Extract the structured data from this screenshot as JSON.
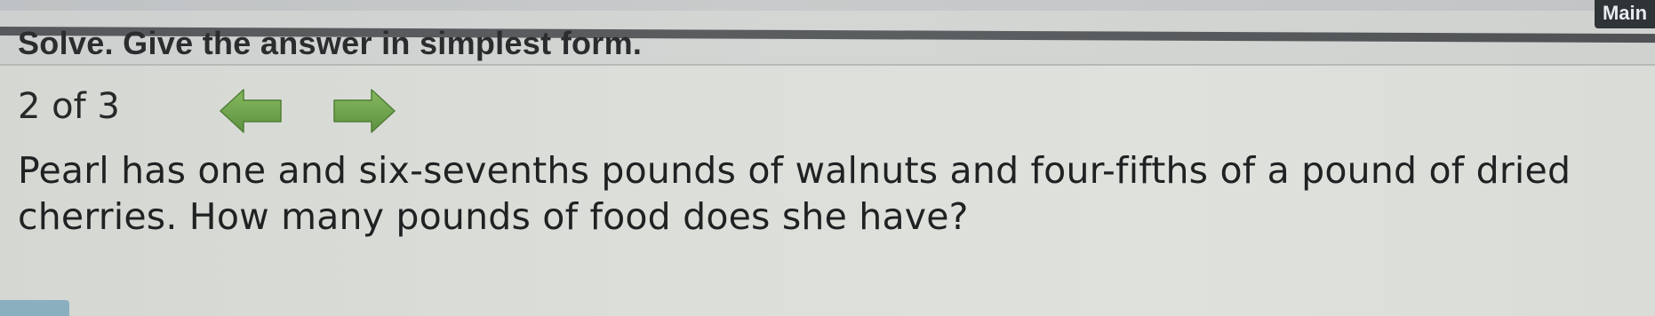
{
  "header": {
    "main_label": "Main"
  },
  "instructions": "Solve. Give the answer in simplest form.",
  "navigation": {
    "counter": "2 of 3",
    "prev_icon": "left-arrow-icon",
    "next_icon": "right-arrow-icon",
    "arrow_color": "#6da04c"
  },
  "question": {
    "text": "Pearl has one and six-sevenths pounds of walnuts and four-fifths of a pound of dried cherries. How many pounds of food does she have?"
  },
  "colors": {
    "background": "#dcdeda",
    "text": "#222425",
    "header_dark": "#2f3436",
    "answer_tab": "#8ab0bf"
  }
}
